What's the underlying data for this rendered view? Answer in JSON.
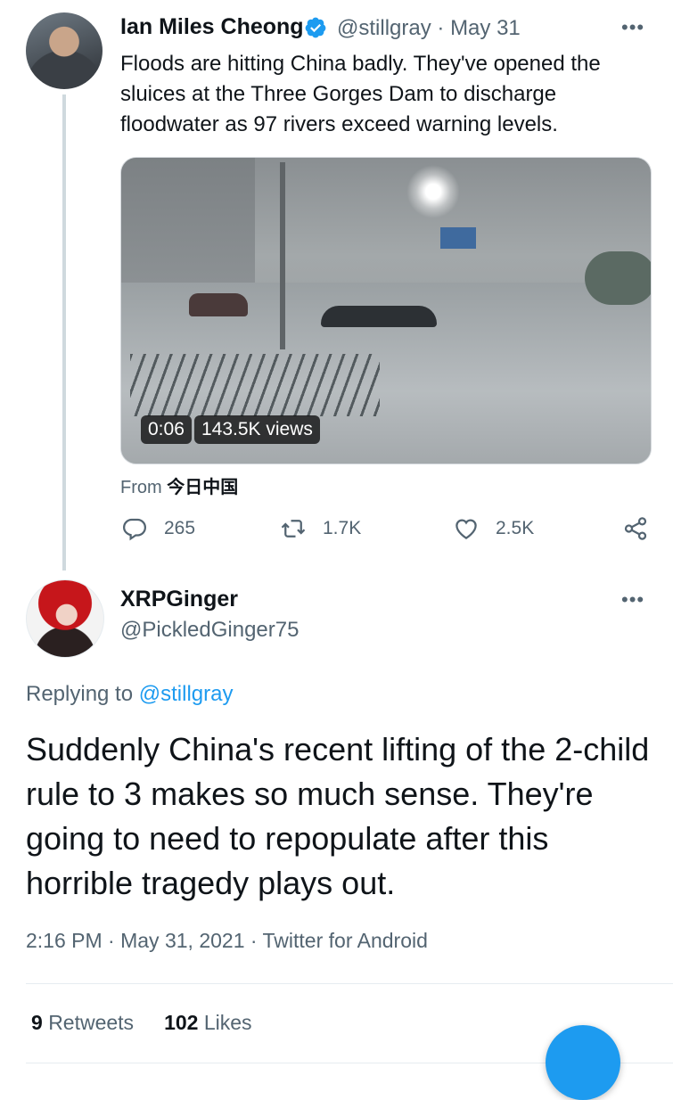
{
  "tweet": {
    "name": "Ian Miles Cheong",
    "handle": "@stillgray",
    "date": "May 31",
    "separator": "·",
    "text": "Floods are hitting China badly. They've opened the sluices at the Three Gorges Dam to discharge floodwater as 97 rivers exceed warning levels.",
    "video": {
      "duration": "0:06",
      "views": "143.5K views"
    },
    "from_prefix": "From",
    "from_source": "今日中国",
    "actions": {
      "replies": "265",
      "retweets": "1.7K",
      "likes": "2.5K"
    },
    "more_icon": "more-icon",
    "verified_icon": "verified-badge-icon"
  },
  "reply": {
    "name": "XRPGinger",
    "handle": "@PickledGinger75",
    "replying_prefix": "Replying to",
    "replying_to": "@stillgray",
    "text": "Suddenly China's recent lifting of the 2-child rule to 3 makes so much sense. They're going to need to repopulate after this horrible tragedy plays out.",
    "time": "2:16 PM",
    "date": "May 31, 2021",
    "client": "Twitter for Android",
    "separator": "·",
    "stats": {
      "retweets_count": "9",
      "retweets_label": "Retweets",
      "likes_count": "102",
      "likes_label": "Likes"
    }
  },
  "colors": {
    "accent": "#1d9bf0",
    "secondary_text": "#536471",
    "text": "#0f1419"
  }
}
